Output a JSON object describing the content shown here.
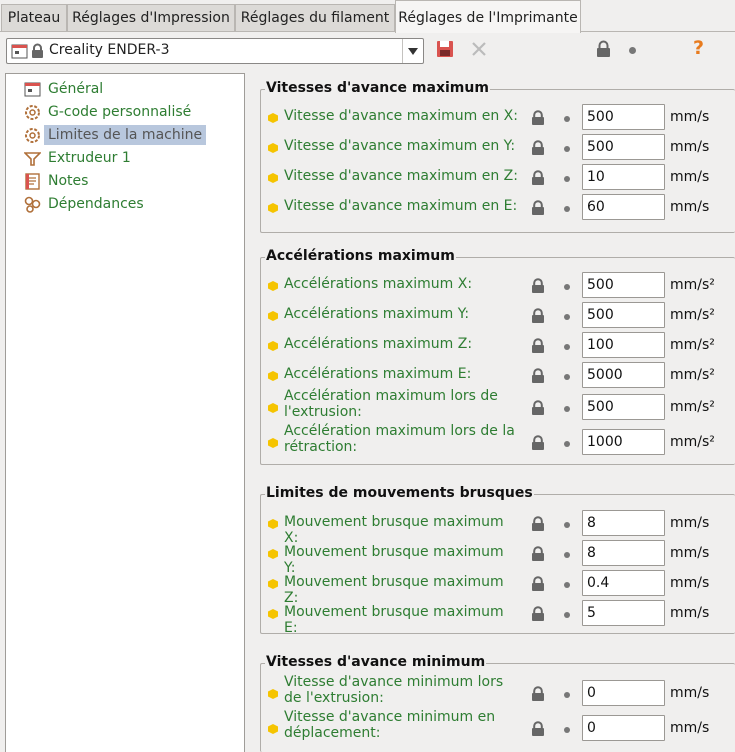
{
  "tabs": [
    {
      "label": "Plateau"
    },
    {
      "label": "Réglages d'Impression"
    },
    {
      "label": "Réglages du filament"
    },
    {
      "label": "Réglages de l'Imprimante"
    }
  ],
  "preset": {
    "name": "Creality ENDER-3"
  },
  "tree": [
    {
      "label": "Général",
      "icon": "printer-icon"
    },
    {
      "label": "G-code personnalisé",
      "icon": "gear-icon"
    },
    {
      "label": "Limites de la machine",
      "icon": "gear-icon",
      "selected": true
    },
    {
      "label": "Extrudeur 1",
      "icon": "funnel-icon"
    },
    {
      "label": "Notes",
      "icon": "notes-icon"
    },
    {
      "label": "Dépendances",
      "icon": "wrench-icon"
    }
  ],
  "groups": [
    {
      "title": "Vitesses d'avance maximum",
      "rows": [
        {
          "label": "Vitesse d'avance maximum en X:",
          "value": "500",
          "unit": "mm/s"
        },
        {
          "label": "Vitesse d'avance maximum en Y:",
          "value": "500",
          "unit": "mm/s"
        },
        {
          "label": "Vitesse d'avance maximum en Z:",
          "value": "10",
          "unit": "mm/s"
        },
        {
          "label": "Vitesse d'avance maximum en E:",
          "value": "60",
          "unit": "mm/s"
        }
      ]
    },
    {
      "title": "Accélérations maximum",
      "rows": [
        {
          "label": "Accélérations maximum X:",
          "value": "500",
          "unit": "mm/s²"
        },
        {
          "label": "Accélérations maximum Y:",
          "value": "500",
          "unit": "mm/s²"
        },
        {
          "label": "Accélérations maximum Z:",
          "value": "100",
          "unit": "mm/s²"
        },
        {
          "label": "Accélérations maximum E:",
          "value": "5000",
          "unit": "mm/s²"
        },
        {
          "label": "Accélération maximum lors de l'extrusion:",
          "value": "500",
          "unit": "mm/s²"
        },
        {
          "label": "Accélération maximum lors de la rétraction:",
          "value": "1000",
          "unit": "mm/s²"
        }
      ]
    },
    {
      "title": "Limites de mouvements brusques",
      "rows": [
        {
          "label": "Mouvement brusque maximum X:",
          "value": "8",
          "unit": "mm/s"
        },
        {
          "label": "Mouvement brusque maximum Y:",
          "value": "8",
          "unit": "mm/s"
        },
        {
          "label": "Mouvement brusque maximum Z:",
          "value": "0.4",
          "unit": "mm/s"
        },
        {
          "label": "Mouvement brusque maximum E:",
          "value": "5",
          "unit": "mm/s"
        }
      ]
    },
    {
      "title": "Vitesses d'avance minimum",
      "rows": [
        {
          "label": "Vitesse d'avance minimum lors de l'extrusion:",
          "value": "0",
          "unit": "mm/s"
        },
        {
          "label": "Vitesse d'avance minimum en déplacement:",
          "value": "0",
          "unit": "mm/s"
        }
      ]
    }
  ],
  "toolbar": {
    "save_icon": "save-icon",
    "delete_icon": "close-icon",
    "lock_icon": "lock-icon",
    "help_label": "?"
  },
  "colors": {
    "accent_green": "#2e7d32",
    "bullet_yellow": "#f5c400",
    "help_orange": "#e87b1e"
  }
}
